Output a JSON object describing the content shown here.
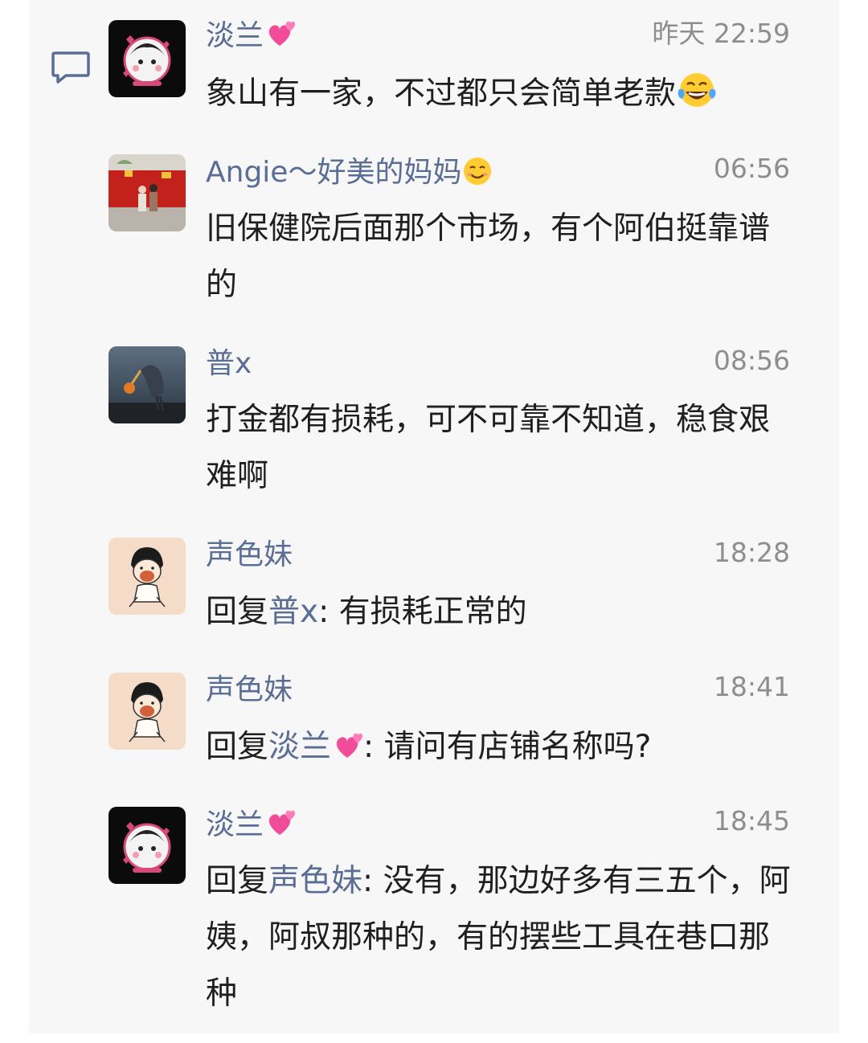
{
  "messages": [
    {
      "avatar": "black-cartoon-girl-avatar",
      "name": "淡兰",
      "name_emoji": "heart-emoji",
      "time": "昨天 22:59",
      "text": "象山有一家，不过都只会简单老款",
      "text_emoji": "laughing-tears-emoji"
    },
    {
      "avatar": "photo-two-people-red-background-avatar",
      "name": "Angie～好美的妈妈",
      "name_emoji": "smiling-face-emoji",
      "time": "06:56",
      "text": "旧保健院后面那个市场，有个阿伯挺靠谱的"
    },
    {
      "avatar": "photo-heron-catching-crab-avatar",
      "name": "普x",
      "time": "08:56",
      "text": "打金都有损耗，可不可靠不知道，稳食艰难啊"
    },
    {
      "avatar": "cartoon-girl-eating-avatar",
      "name": "声色妹",
      "time": "18:28",
      "reply_prefix": "回复",
      "reply_to": "普x",
      "text": ": 有损耗正常的"
    },
    {
      "avatar": "cartoon-girl-eating-avatar",
      "name": "声色妹",
      "time": "18:41",
      "reply_prefix": "回复",
      "reply_to": "淡兰",
      "reply_to_emoji": "heart-emoji",
      "text": ": 请问有店铺名称吗?"
    },
    {
      "avatar": "black-cartoon-girl-avatar",
      "name": "淡兰",
      "name_emoji": "heart-emoji",
      "time": "18:45",
      "reply_prefix": "回复",
      "reply_to": "声色妹",
      "text": ": 没有，那边好多有三五个，阿姨，阿叔那种的，有的摆些工具在巷口那种"
    }
  ],
  "colors": {
    "name": "#5a6e95",
    "time": "#8e8e8e",
    "text": "#1f1f1f",
    "panel": "#f7f7f7"
  }
}
